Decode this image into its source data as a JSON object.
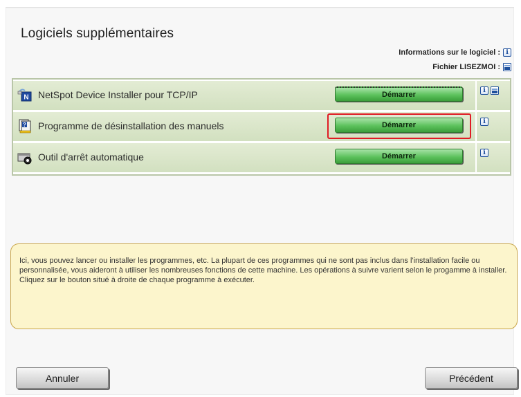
{
  "page": {
    "title": "Logiciels supplémentaires",
    "legend": {
      "info_label": "Informations sur le logiciel :",
      "readme_label": "Fichier LISEZMOI :"
    },
    "programs": [
      {
        "name": "NetSpot Device Installer pour TCP/IP",
        "button": "Démarrer",
        "icon": "netspot-installer-icon"
      },
      {
        "name": "Programme de désinstallation des manuels",
        "button": "Démarrer",
        "icon": "manual-uninstall-icon"
      },
      {
        "name": "Outil d'arrêt automatique",
        "button": "Démarrer",
        "icon": "auto-shutdown-icon"
      }
    ],
    "description": "Ici, vous pouvez lancer ou installer les programmes, etc. La plupart de ces programmes qui ne sont pas inclus dans l'installation facile ou personnalisée, vous aideront à utiliser les nombreuses fonctions de cette machine. Les opérations à suivre varient selon le progamme à installer. Cliquez sur le bouton situé à droite de chaque programme à exécuter.",
    "buttons": {
      "cancel": "Annuler",
      "back": "Précédent"
    },
    "colors": {
      "start_button": "#5cc15c",
      "row_background": "#d9e5c8",
      "highlight": "#e01b24",
      "description_background": "#fcf5cc"
    }
  }
}
